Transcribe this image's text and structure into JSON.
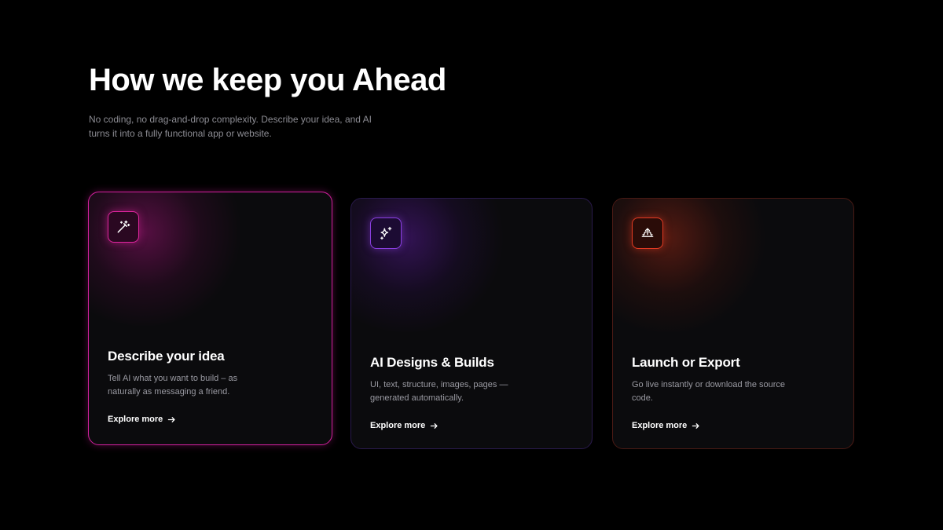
{
  "section": {
    "title": "How we keep you Ahead",
    "subtitle": "No coding, no drag-and-drop complexity. Describe your idea, and AI turns it into a fully functional app or website."
  },
  "cards": [
    {
      "icon": "magic-wand-icon",
      "title": "Describe your idea",
      "description": "Tell AI what you want to build – as naturally as messaging a friend.",
      "link_label": "Explore more",
      "accent": "#e0259f"
    },
    {
      "icon": "sparkles-icon",
      "title": "AI Designs & Builds",
      "description": "UI, text, structure, images, pages — generated automatically.",
      "link_label": "Explore more",
      "accent": "#8a3fe0"
    },
    {
      "icon": "upload-launch-icon",
      "title": "Launch or Export",
      "description": "Go live instantly or download the source code.",
      "link_label": "Explore more",
      "accent": "#e23a22"
    }
  ],
  "colors": {
    "background": "#000000",
    "card_background": "#0b0b0d",
    "muted_text": "#8c8c93"
  }
}
